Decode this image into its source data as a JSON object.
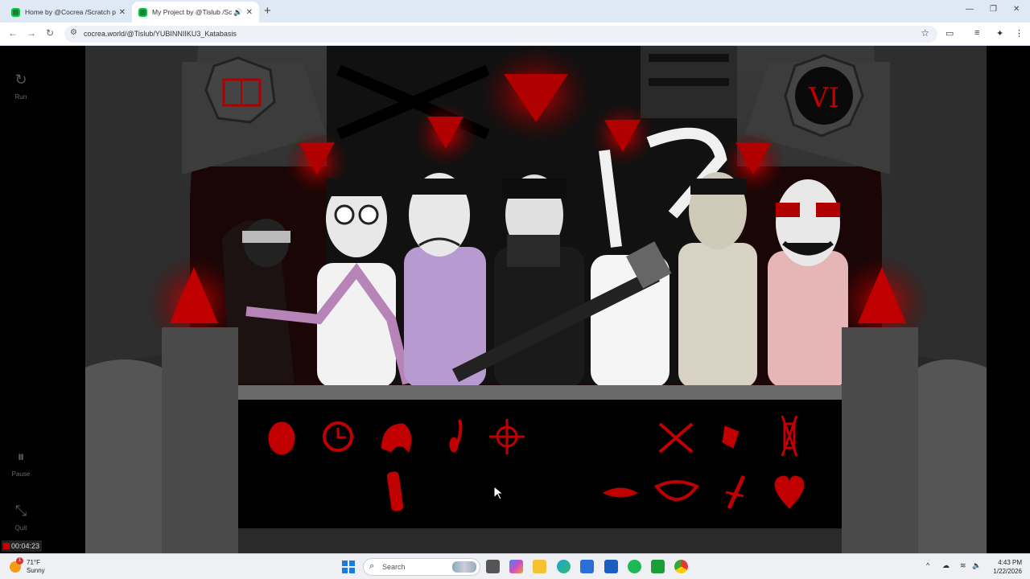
{
  "browser": {
    "tabs": [
      {
        "title": "Home by @Cocrea /Scratch pro",
        "active": false
      },
      {
        "title": "My Project by @Tislub /Scra",
        "active": true
      }
    ],
    "url": "cocrea.world/@Tislub/YUBINNIIKU3_Katabasis"
  },
  "player": {
    "run_label": "Run",
    "pause_label": "Pause",
    "quit_label": "Quit",
    "timer": "00:04:23",
    "badge_numeral": "VI",
    "accent_color": "#c00000"
  },
  "taskbar": {
    "weather_temp": "71°F",
    "weather_desc": "Sunny",
    "weather_badge": "1",
    "search_placeholder": "Search",
    "time": "4:43 PM",
    "date": "1/22/2026"
  }
}
